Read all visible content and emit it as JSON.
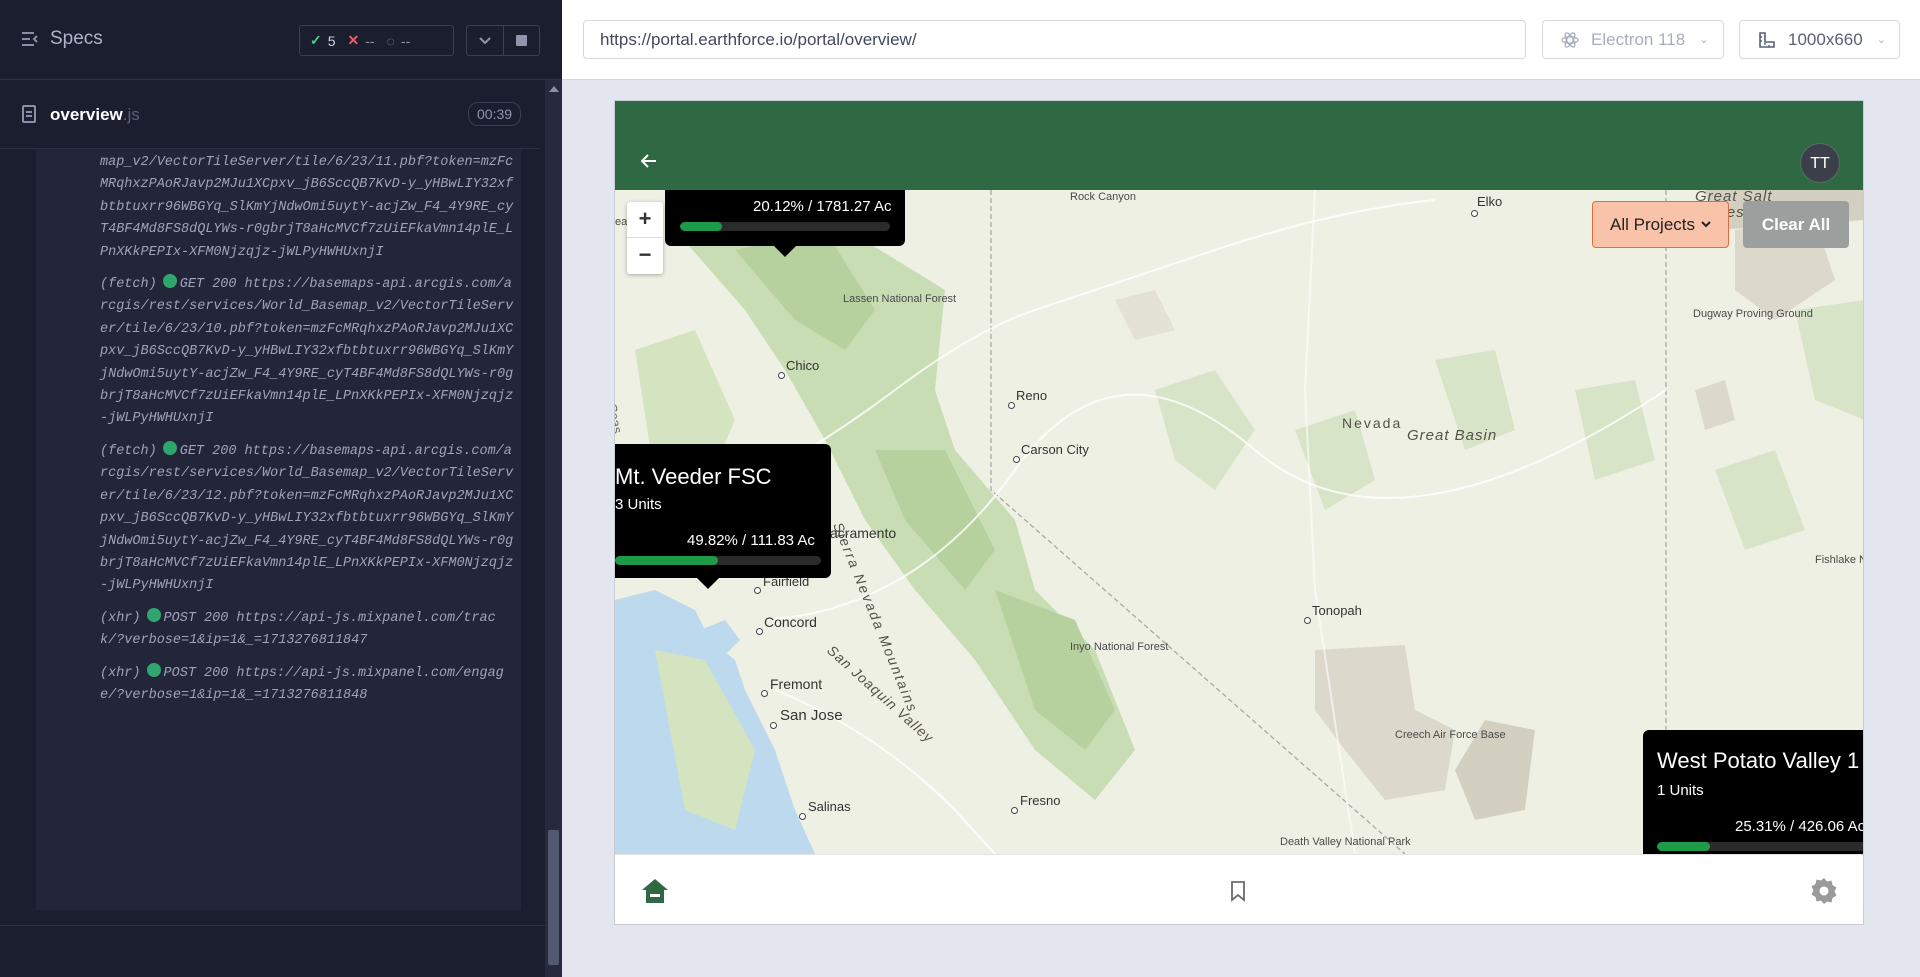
{
  "reporter": {
    "title": "Specs",
    "stats": {
      "passed": "5",
      "failed": "--",
      "pending": "--"
    },
    "spec": {
      "name": "overview",
      "ext": ".js",
      "time": "00:39"
    },
    "log_top_fragment": "map_v2/VectorTileServer/tile/6/23/11.pbf?token=mzFcMRqhxzPAoRJavp2MJu1XCpxv_jB6SccQB7KvD-y_yHBwLIY32xfbtbtuxrr96WBGYq_SlKmYjNdwOmi5uytY-acjZw_F4_4Y9RE_cyT4BF4Md8FS8dQLYWs-r0gbrjT8aHcMVCf7zUiEFkaVmn14plE_LPnXKkPEPIx-XFM0Njzqjz-jWLPyHWHUxnjI",
    "log_entries": [
      {
        "type": "(fetch)",
        "text": "GET 200 https://basemaps-api.arcgis.com/arcgis/rest/services/World_Basemap_v2/VectorTileServer/tile/6/23/10.pbf?token=mzFcMRqhxzPAoRJavp2MJu1XCpxv_jB6SccQB7KvD-y_yHBwLIY32xfbtbtuxrr96WBGYq_SlKmYjNdwOmi5uytY-acjZw_F4_4Y9RE_cyT4BF4Md8FS8dQLYWs-r0gbrjT8aHcMVCf7zUiEFkaVmn14plE_LPnXKkPEPIx-XFM0Njzqjz-jWLPyHWHUxnjI"
      },
      {
        "type": "(fetch)",
        "text": "GET 200 https://basemaps-api.arcgis.com/arcgis/rest/services/World_Basemap_v2/VectorTileServer/tile/6/23/12.pbf?token=mzFcMRqhxzPAoRJavp2MJu1XCpxv_jB6SccQB7KvD-y_yHBwLIY32xfbtbtuxrr96WBGYq_SlKmYjNdwOmi5uytY-acjZw_F4_4Y9RE_cyT4BF4Md8FS8dQLYWs-r0gbrjT8aHcMVCf7zUiEFkaVmn14plE_LPnXKkPEPIx-XFM0Njzqjz-jWLPyHWHUxnjI"
      },
      {
        "type": "(xhr)",
        "text": "POST 200 https://api-js.mixpanel.com/track/?verbose=1&ip=1&_=1713276811847"
      },
      {
        "type": "(xhr)",
        "text": "POST 200 https://api-js.mixpanel.com/engage/?verbose=1&ip=1&_=1713276811848"
      }
    ]
  },
  "browser": {
    "url": "https://portal.earthforce.io/portal/overview/",
    "engine": "Electron 118",
    "viewport": "1000x660"
  },
  "app": {
    "avatar": "TT",
    "all_projects_label": "All Projects",
    "clear_all_label": "Clear All",
    "popups": [
      {
        "name": "",
        "units": "",
        "pct": "20.12% / 1781.27 Ac",
        "progress": 0.2012
      },
      {
        "name": "Mt. Veeder FSC",
        "units": "3 Units",
        "pct": "49.82% / 111.83 Ac",
        "progress": 0.4982
      },
      {
        "name": "West Potato Valley 1",
        "units": "1 Units",
        "pct": "25.31% / 426.06 Ac",
        "progress": 0.2531
      }
    ],
    "map_labels": {
      "rock_canyon": "Rock Canyon",
      "elko": "Elko",
      "great_salt": "Great Salt",
      "desert": "Desert",
      "dugway": "Dugway Proving Ground",
      "lassen": "Lassen National Forest",
      "chico": "Chico",
      "reno": "Reno",
      "carson_city": "Carson City",
      "sierra_nevada": "Sierra Nevada Mountains",
      "nevada": "Nevada",
      "great_basin": "Great Basin",
      "sacramento": "acramento",
      "fairfield": "Fairfield",
      "concord": "Concord",
      "fremont": "Fremont",
      "san_jose": "San Jose",
      "salinas": "Salinas",
      "fresno": "Fresno",
      "san_joaquin": "San Joaquin Valley",
      "inyo": "Inyo National Forest",
      "tonopah": "Tonopah",
      "creech": "Creech Air Force Base",
      "death_valley": "Death Valley National Park",
      "fishlake": "Fishlake National F",
      "coast": "Coas",
      "eat": "eat"
    }
  },
  "colors": {
    "header_green": "#2f6944",
    "progress_green": "#1e9b48",
    "all_projects_bg": "#f9c3a9",
    "reporter_bg": "#1b1e2e"
  }
}
